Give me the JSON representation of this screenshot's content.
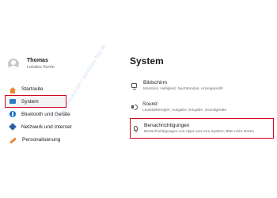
{
  "watermark": "www.tutonaut.de / windows-faq.de",
  "user": {
    "name": "Thomas",
    "account": "Lokales Konto"
  },
  "sidebar": {
    "items": [
      {
        "label": "Startseite",
        "icon": "home-icon"
      },
      {
        "label": "System",
        "icon": "system-icon",
        "selected": true
      },
      {
        "label": "Bluetooth und Geräte",
        "icon": "bluetooth-icon"
      },
      {
        "label": "Netzwerk und Internet",
        "icon": "network-icon"
      },
      {
        "label": "Personalisierung",
        "icon": "brush-icon"
      }
    ]
  },
  "main": {
    "title": "System",
    "settings": [
      {
        "title": "Bildschirm",
        "description": "Monitore, Helligkeit, Nachtmodus, Anzeigeprofil",
        "icon": "monitor-icon"
      },
      {
        "title": "Sound",
        "description": "Lautstärkeregler, Ausgabe, Eingabe, Soundgeräte",
        "icon": "speaker-icon"
      },
      {
        "title": "Benachrichtigungen",
        "description": "Benachrichtigungen von Apps und vom System, Bitte nicht stören",
        "icon": "bell-icon",
        "highlighted": true
      }
    ]
  },
  "colors": {
    "highlight_border": "#d0021b",
    "accent": "#2a7bc4"
  }
}
